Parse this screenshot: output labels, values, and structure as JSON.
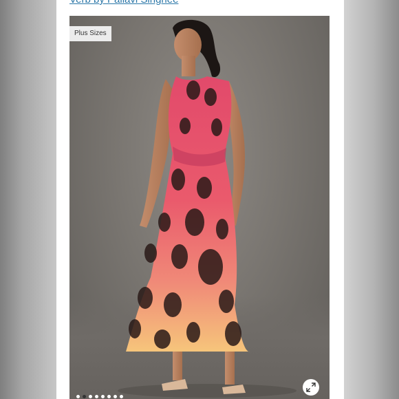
{
  "brand": {
    "link_label": "Verb by Pallavi Singhee"
  },
  "gallery": {
    "badge": "Plus Sizes",
    "slide_count": 8,
    "active_slide": 2,
    "expand_icon": "expand-icon"
  },
  "colors": {
    "link": "#2b77a8",
    "dress_top": "#e0506e",
    "dress_bottom": "#f5c27a",
    "print": "#2a1a18"
  }
}
